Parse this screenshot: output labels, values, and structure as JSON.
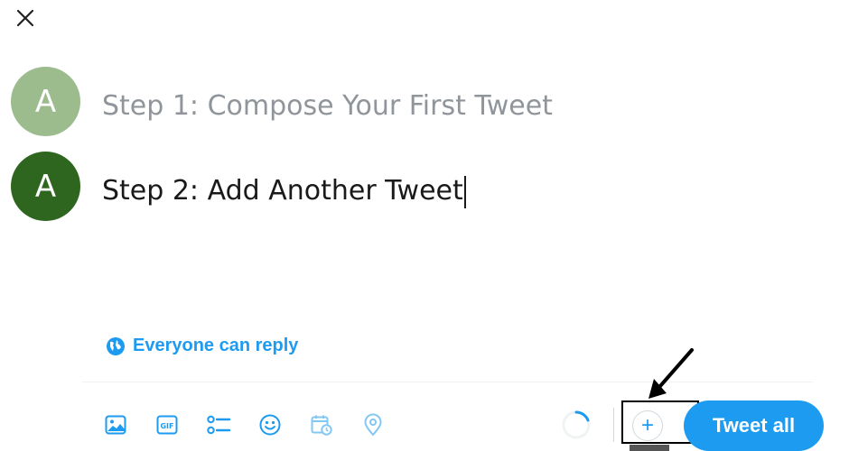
{
  "header": {
    "close_icon": "close-icon"
  },
  "thread": [
    {
      "avatar_letter": "A",
      "avatar_color": "#9cbc8e",
      "text": "Step 1: Compose Your First Tweet",
      "text_color": "#8f959a"
    },
    {
      "avatar_letter": "A",
      "avatar_color": "#2e6620",
      "text": "Step 2: Add Another Tweet",
      "text_color": "#1a1a1a"
    }
  ],
  "reply_setting": {
    "label": "Everyone can reply",
    "icon": "globe-icon"
  },
  "toolbar": {
    "icons": [
      "image-icon",
      "gif-icon",
      "poll-icon",
      "emoji-icon",
      "schedule-icon",
      "location-icon"
    ],
    "add_tweet_label": "+",
    "tweet_all_label": "Tweet all"
  },
  "colors": {
    "accent": "#1d9bf0"
  }
}
